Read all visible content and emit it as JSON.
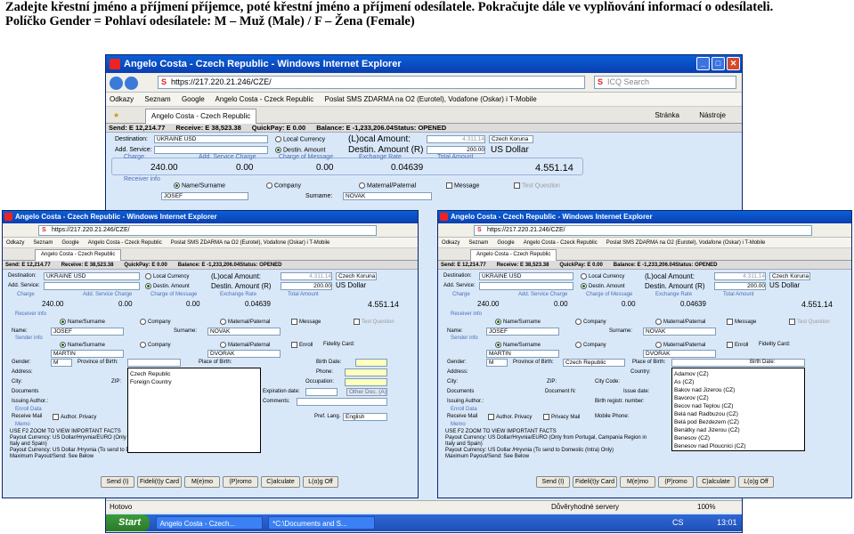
{
  "header": {
    "line1": "Zadejte křestní jméno a příjmení příjemce, poté křestní jméno a příjmení odesílatele. Pokračujte dále ve vyplňování informací o odesílateli.",
    "line2": "Políčko Gender = Pohlaví odesílatele: M – Muž (Male) / F – Žena (Female)"
  },
  "window": {
    "title": "Angelo Costa - Czech Republic - Windows Internet Explorer",
    "url": "https://217.220.21.246/CZE/",
    "search_placeholder": "ICQ Search",
    "favorites": [
      "Odkazy",
      "Seznam",
      "Google",
      "Angelo Costa - Czeck Republic",
      "Poslat SMS ZDARMA na O2 (Eurotel), Vodafone (Oskar) i T-Mobile"
    ],
    "tab": "Angelo Costa - Czech Republic",
    "stranka": "Stránka",
    "nastroje": "Nástroje"
  },
  "infobar": {
    "send": "Send: E 12,214.77",
    "receive": "Receive: E 38,523.38",
    "quickpay": "QuickPay: E 0.00",
    "balance": "Balance: E -1,233,206.04Status: OPENED"
  },
  "form": {
    "destination_label": "Destination:",
    "destination": "UKRAINE USD",
    "add_service_label": "Add. Service:",
    "local_currency": "Local Currency",
    "destin_amount": "Destin. Amount",
    "local_amount_label": "(L)ocal Amount:",
    "destin_amount_label": "Destin. Amount (R)",
    "local_amount_value": "4.311.14",
    "currency_local": "Czech Koruna",
    "destin_value": "200.00",
    "currency_destin": "US Dollar",
    "charge_label": "Charge",
    "add_charge_label": "Add. Service Charge",
    "charge_msg_label": "Charge of Message",
    "rate_label": "Exchange Rate",
    "total_label": "Total Amount",
    "charge": "240.00",
    "add_charge": "0.00",
    "charge_msg": "0.00",
    "rate": "0.04639",
    "total": "4.551.14",
    "receiver_info": "Receiver info",
    "name_surname": "Name/Surname",
    "company": "Company",
    "maternal": "Maternal/Paternal",
    "message": "Message",
    "test_question": "Test Question",
    "name_label": "Name:",
    "surname_label": "Surname:",
    "receiver_name": "JOSEF",
    "receiver_surname": "NOVAK",
    "sender_info": "Sender info",
    "enroll": "Enroll",
    "fidelity": "Fidelity Card:",
    "sender_name": "MARTIN",
    "sender_surname": "DVORAK",
    "gender_label": "Gender:",
    "gender": "M",
    "province_label": "Province of Birth:",
    "place_label": "Place of Birth:",
    "birth_date": "Birth Date:",
    "address": "Address:",
    "country": "Country:",
    "phone": "Phone:",
    "city": "City:",
    "zip": "ZIP:",
    "city_code": "City Code:",
    "occupation": "Occupation:",
    "documents": "Documents",
    "document_no": "Document N:",
    "issue_date": "Issue date:",
    "expiration": "Expiration date:",
    "birth_reg": "Birth registr. number:",
    "issuing_author": "Issuing Author.:",
    "comments": "Comments:",
    "other_doc": "Other Doc. (A)",
    "enroll_data": "Enroll Data",
    "receive_mail": "Receive Mail",
    "author_privacy": "Author. Privacy",
    "privacy_mail": "Privacy Mail",
    "mobile_phone": "Mobile Phone:",
    "pref_lang": "Pref. Lang.",
    "english": "English",
    "memo": "Memo",
    "memo_lines": [
      "USE F2 ZOOM TO VIEW IMPORTANT FACTS",
      "Payout Currency: US Dollar/Hryvnia/EURO (Only from Portugal, Campania Region in",
      "Italy and Spain)",
      "Payout Currency: US Dollar /Hryvnia (To send to Domestic (Intra) Only)",
      "Maximum Payout/Send: See Below"
    ],
    "province_value": "Czech Republic"
  },
  "dropdown_left": [
    "Czech Republic",
    "Foreign Country"
  ],
  "dropdown_right": [
    "Adamov (CZ)",
    "As (CZ)",
    "Bakov nad Jizerou (CZ)",
    "Bavorov (CZ)",
    "Becov nad Teplou (CZ)",
    "Belá nad Radbuzou (CZ)",
    "Belá pod Bezdezem (CZ)",
    "Benátky nad Jizerou (CZ)",
    "Benesov (CZ)",
    "Benesov nad Ploucnici (CZ)"
  ],
  "buttons": [
    "Send (I)",
    "Fideli(t)y Card",
    "M(e)mo",
    "(P)romo",
    "C)alculate",
    "L(o)g Off"
  ],
  "status": {
    "left": "Hotovo",
    "zone": "Důvěryhodné servery",
    "zoom": "100%"
  },
  "taskbar": {
    "start": "Start",
    "task1": "Angelo Costa - Czech...",
    "task2": "*C:\\Documents and S...",
    "lang": "CS",
    "clock": "13:01"
  }
}
